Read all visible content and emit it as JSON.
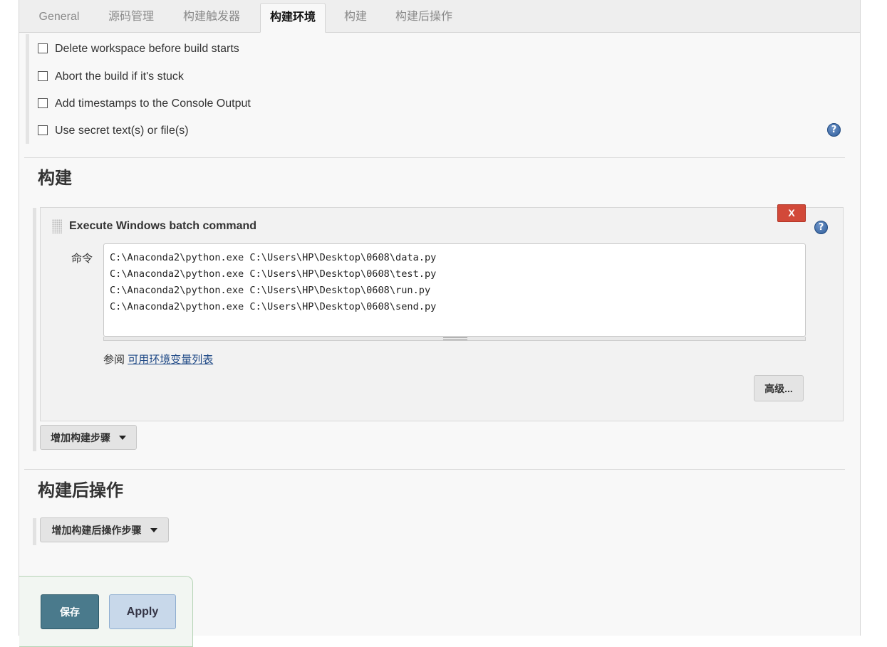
{
  "tabs": [
    {
      "label": "General"
    },
    {
      "label": "源码管理"
    },
    {
      "label": "构建触发器"
    },
    {
      "label": "构建环境",
      "active": true
    },
    {
      "label": "构建"
    },
    {
      "label": "构建后操作"
    }
  ],
  "build_env": {
    "options": [
      {
        "label": "Delete workspace before build starts",
        "checked": false
      },
      {
        "label": "Abort the build if it's stuck",
        "checked": false
      },
      {
        "label": "Add timestamps to the Console Output",
        "checked": false
      },
      {
        "label": "Use secret text(s) or file(s)",
        "checked": false
      }
    ],
    "help_icon": "?"
  },
  "build": {
    "title": "构建",
    "step": {
      "title": "Execute Windows batch command",
      "delete_label": "X",
      "help_icon": "?",
      "command_label": "命令",
      "command_lines": [
        "C:\\Anaconda2\\python.exe C:\\Users\\HP\\Desktop\\0608\\data.py",
        "C:\\Anaconda2\\python.exe C:\\Users\\HP\\Desktop\\0608\\test.py",
        "C:\\Anaconda2\\python.exe C:\\Users\\HP\\Desktop\\0608\\run.py",
        "C:\\Anaconda2\\python.exe C:\\Users\\HP\\Desktop\\0608\\send.py"
      ],
      "see_also_prefix": "参阅",
      "see_also_link": "可用环境变量列表",
      "advanced_label": "高级..."
    },
    "add_step_label": "增加构建步骤"
  },
  "post_build": {
    "title": "构建后操作",
    "add_step_label": "增加构建后操作步骤"
  },
  "actions": {
    "save_label": "保存",
    "apply_label": "Apply"
  }
}
